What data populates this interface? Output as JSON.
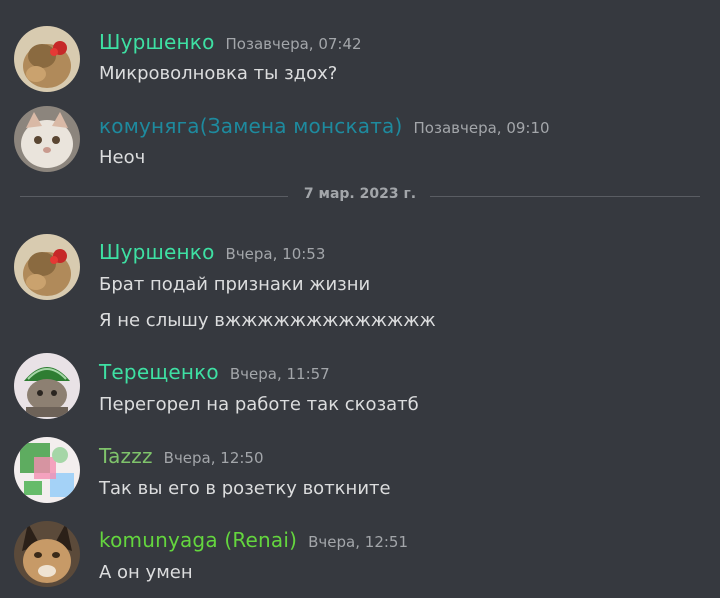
{
  "colors": {
    "background": "#36393f",
    "text": "#dcddde",
    "timestamp": "#a3a6aa",
    "name_green": "#3ee0a3",
    "name_teal": "#1e8a9e",
    "name_lime": "#7fc36b",
    "name_bright_green": "#64d63e"
  },
  "divider": {
    "date": "7 мар. 2023 г."
  },
  "messages": [
    {
      "author": "Шуршенко",
      "timestamp": "Позавчера, 07:42",
      "lines": [
        "Микроволновка ты здох?"
      ],
      "avatar": "cat-with-bow-avatar"
    },
    {
      "author": "комуняга(Замена монската)",
      "timestamp": "Позавчера, 09:10",
      "lines": [
        "Неоч"
      ],
      "avatar": "fluffy-cat-avatar"
    },
    {
      "author": "Шуршенко",
      "timestamp": "Вчера, 10:53",
      "lines": [
        "Брат подай признаки жизни",
        "Я не слышу вжжжжжжжжжжжжж"
      ],
      "avatar": "cat-with-bow-avatar"
    },
    {
      "author": "Терещенко",
      "timestamp": "Вчера, 11:57",
      "lines": [
        "Перегорел на работе так скозатб"
      ],
      "avatar": "watermelon-hat-cat-avatar"
    },
    {
      "author": "Tazzz",
      "timestamp": "Вчера, 12:50",
      "lines": [
        "Так вы его в розетку воткните"
      ],
      "avatar": "pixel-cat-avatar"
    },
    {
      "author": "komunyaga (Renai)",
      "timestamp": "Вчера, 12:51",
      "lines": [
        "А он умен"
      ],
      "avatar": "caracal-avatar"
    }
  ]
}
